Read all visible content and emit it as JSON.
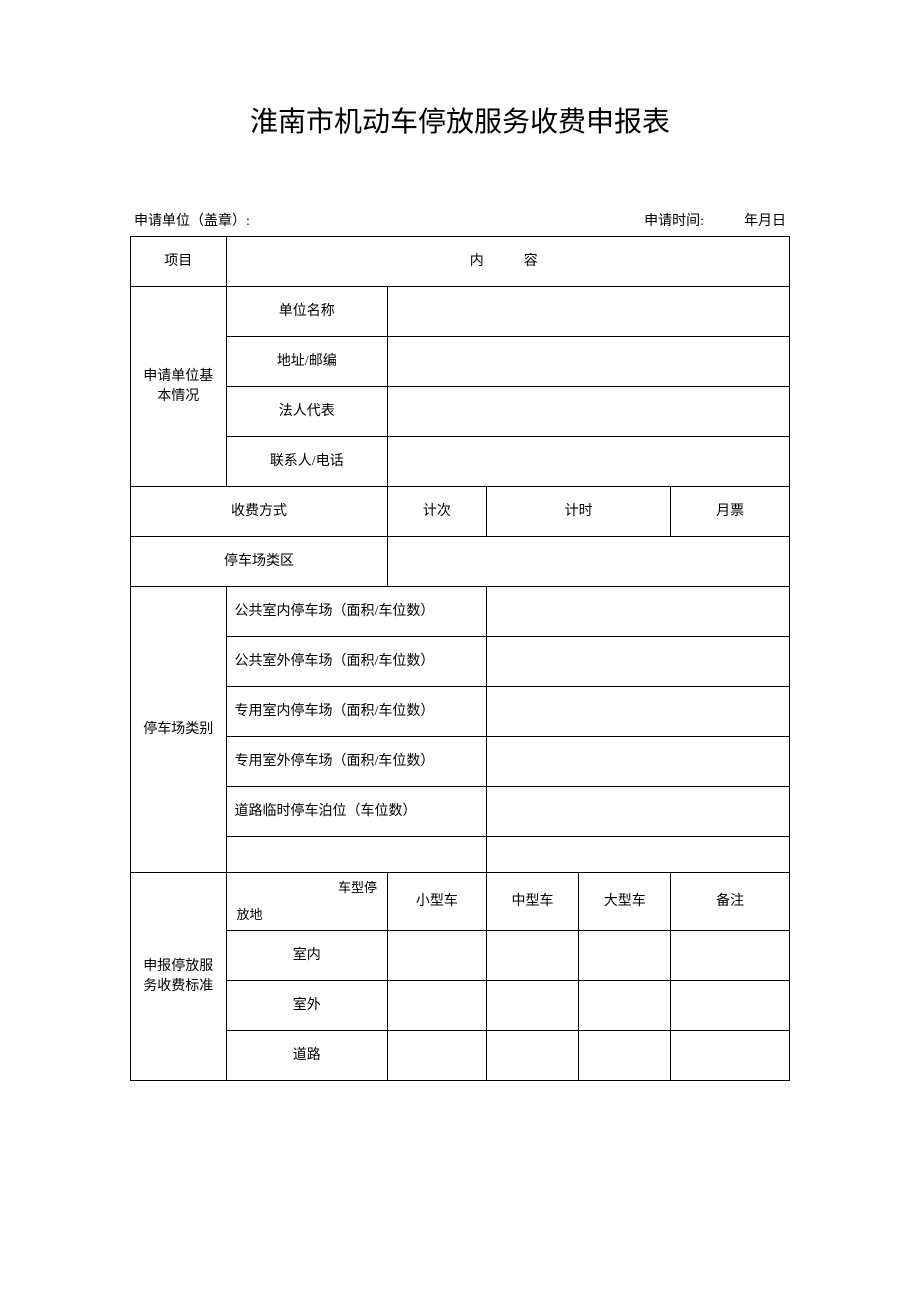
{
  "title": "淮南市机动车停放服务收费申报表",
  "header": {
    "applicant_unit_label": "申请单位（盖章）:",
    "apply_time_label": "申请时间:",
    "date_placeholder": "年月日"
  },
  "row_project": {
    "label": "项目",
    "content_label": "内容"
  },
  "basic_info": {
    "section_label": "申请单位基本情况",
    "unit_name_label": "单位名称",
    "address_label": "地址/邮编",
    "legal_rep_label": "法人代表",
    "contact_label": "联系人/电话"
  },
  "fee_method": {
    "label": "收费方式",
    "by_count": "计次",
    "by_time": "计时",
    "monthly": "月票"
  },
  "parking_zone": {
    "label": "停车场类区"
  },
  "parking_category": {
    "section_label": "停车场类别",
    "rows": [
      "公共室内停车场（面积/车位数）",
      "公共室外停车场（面积/车位数）",
      "专用室内停车场（面积/车位数）",
      "专用室外停车场（面积/车位数）",
      "道路临时停车泊位（车位数）"
    ]
  },
  "fee_standard": {
    "section_label": "申报停放服务收费标准",
    "diag_top": "车型停",
    "diag_bottom": "放地",
    "cols": {
      "small": "小型车",
      "medium": "中型车",
      "large": "大型车",
      "remark": "备注"
    },
    "rows": {
      "indoor": "室内",
      "outdoor": "室外",
      "road": "道路"
    }
  }
}
